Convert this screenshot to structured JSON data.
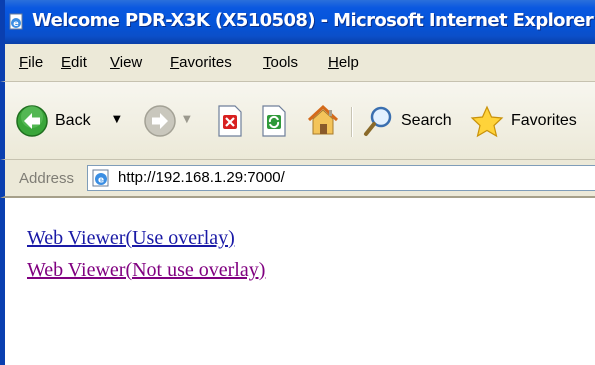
{
  "window": {
    "title": "Welcome PDR-X3K (X510508) - Microsoft Internet Explorer"
  },
  "menu": {
    "items": [
      "File",
      "Edit",
      "View",
      "Favorites",
      "Tools",
      "Help"
    ]
  },
  "toolbar": {
    "back_label": "Back",
    "search_label": "Search",
    "favorites_label": "Favorites"
  },
  "address": {
    "label": "Address",
    "url": "http://192.168.1.29:7000/"
  },
  "content": {
    "links": [
      {
        "label": "Web Viewer(Use overlay)",
        "color": "#1a1aa6"
      },
      {
        "label": "Web Viewer(Not use overlay)",
        "color": "#800080"
      }
    ]
  },
  "colors": {
    "title_bar": "#0454da",
    "chrome": "#ece9d8",
    "link": "#1a1aa6",
    "visited_link": "#800080"
  },
  "icons": [
    "ie-page-icon",
    "back-arrow-icon",
    "forward-arrow-icon",
    "stop-icon",
    "refresh-icon",
    "home-icon",
    "search-icon",
    "favorites-star-icon",
    "ie-address-icon"
  ]
}
